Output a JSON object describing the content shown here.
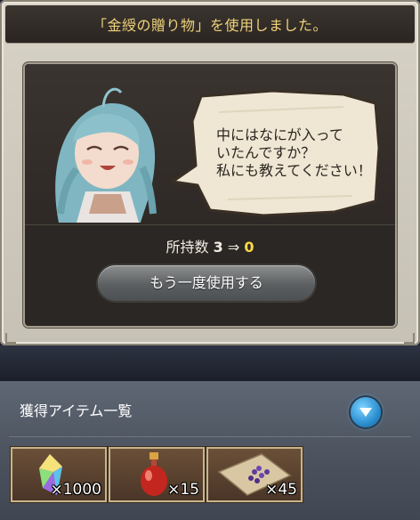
{
  "dialog": {
    "title": "「金綬の贈り物」を使用しました。",
    "speech": "中にはなにが入って\nいたんですか？\n私にも教えてください！",
    "count": {
      "label": "所持数",
      "before": "3",
      "arrow": "⇒",
      "after": "0"
    },
    "reuse_button": "もう一度使用する"
  },
  "acquired": {
    "title": "獲得アイテム一覧",
    "expand_icon": "chevron-down-icon",
    "items": [
      {
        "icon": "crystal-icon",
        "quantity": "×1000"
      },
      {
        "icon": "potion-icon",
        "quantity": "×15"
      },
      {
        "icon": "scroll-icon",
        "quantity": "×45"
      }
    ]
  },
  "colors": {
    "title_text": "#f0d27a",
    "count_after": "#ffd94a",
    "expand_button": "#2a8fd0"
  }
}
